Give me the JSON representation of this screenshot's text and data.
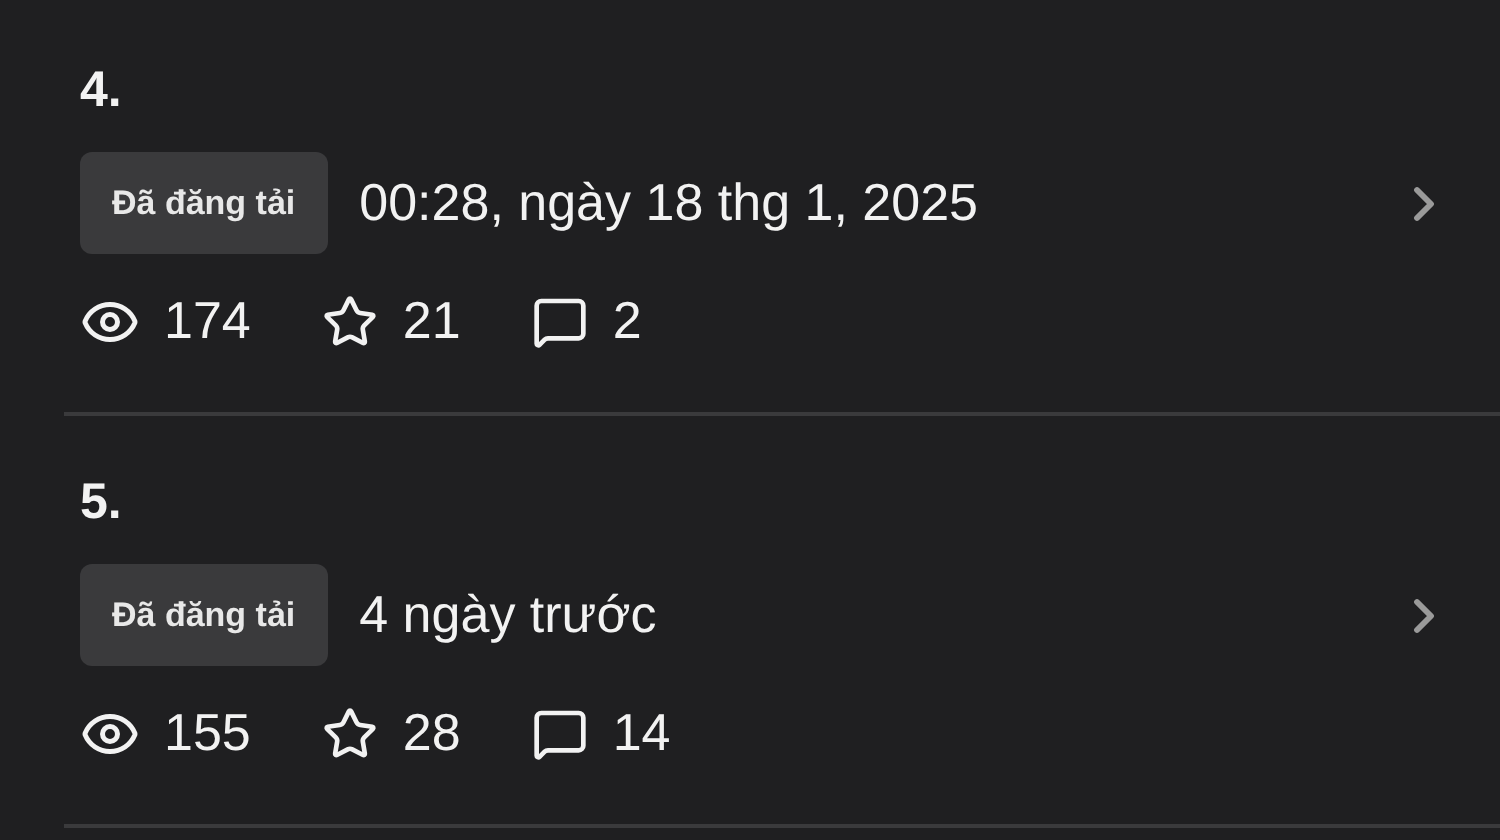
{
  "chapters": [
    {
      "number": "4.",
      "status": "Đã đăng tải",
      "time": "00:28, ngày 18 thg 1, 2025",
      "views": "174",
      "stars": "21",
      "comments": "2"
    },
    {
      "number": "5.",
      "status": "Đã đăng tải",
      "time": "4 ngày trước",
      "views": "155",
      "stars": "28",
      "comments": "14"
    }
  ]
}
